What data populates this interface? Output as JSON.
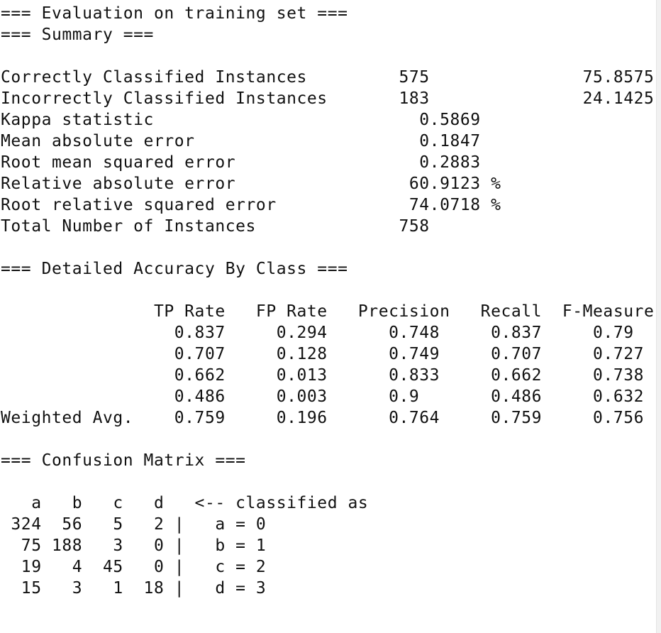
{
  "report_text": "=== Evaluation on training set ===\n=== Summary ===\n\nCorrectly Classified Instances         575               75.8575 %\nIncorrectly Classified Instances       183               24.1425 %\nKappa statistic                          0.5869\nMean absolute error                      0.1847\nRoot mean squared error                  0.2883\nRelative absolute error                 60.9123 %\nRoot relative squared error             74.0718 %\nTotal Number of Instances              758     \n\n=== Detailed Accuracy By Class ===\n\n               TP Rate   FP Rate   Precision   Recall  F-Measure\n                 0.837     0.294      0.748     0.837     0.79 \n                 0.707     0.128      0.749     0.707     0.727\n                 0.662     0.013      0.833     0.662     0.738\n                 0.486     0.003      0.9       0.486     0.632\nWeighted Avg.    0.759     0.196      0.764     0.759     0.756\n\n=== Confusion Matrix ===\n\n   a   b   c   d   <-- classified as\n 324  56   5   2 |   a = 0\n  75 188   3   0 |   b = 1\n  19   4  45   0 |   c = 2\n  15   3   1  18 |   d = 3"
}
